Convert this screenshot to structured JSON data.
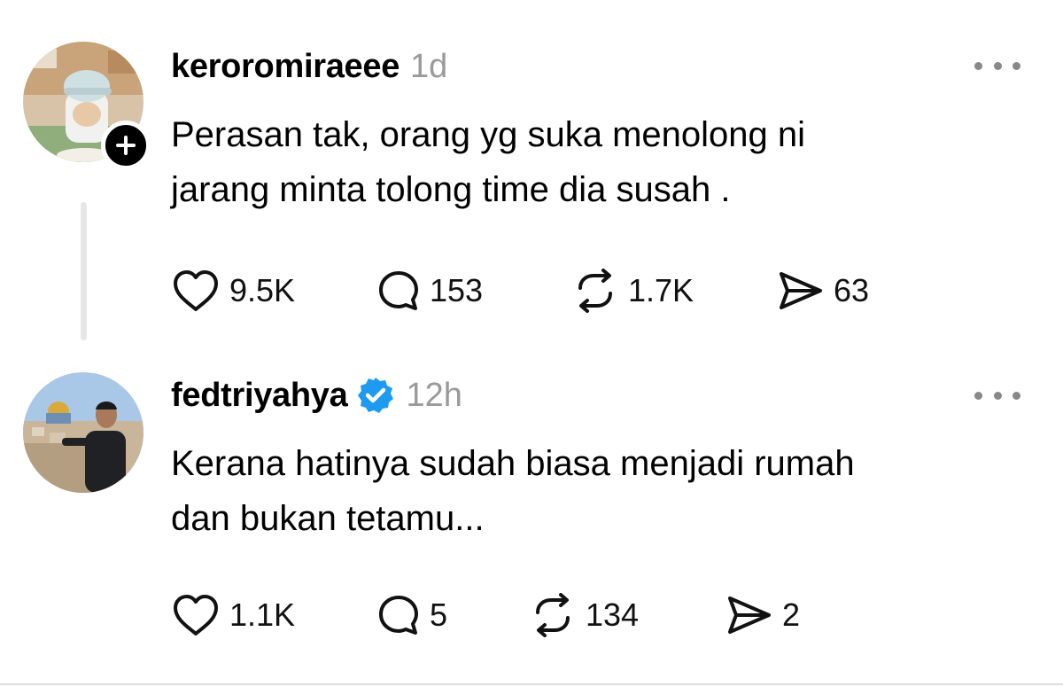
{
  "posts": [
    {
      "username": "keroromiraeee",
      "timestamp": "1d",
      "verified": false,
      "lines": [
        "Perasan tak, orang yg suka menolong ni",
        "jarang minta tolong time dia susah ."
      ],
      "likes": "9.5K",
      "replies": "153",
      "reposts": "1.7K",
      "shares": "63"
    },
    {
      "username": "fedtriyahya",
      "timestamp": "12h",
      "verified": true,
      "lines": [
        "Kerana hatinya sudah biasa menjadi rumah",
        "dan bukan tetamu..."
      ],
      "likes": "1.1K",
      "replies": "5",
      "reposts": "134",
      "shares": "2"
    }
  ],
  "colors": {
    "verified_badge": "#1d9bf0",
    "timestamp": "#9a9a9a",
    "thread_line": "#e6e6e6"
  },
  "icons": [
    "heart-icon",
    "comment-icon",
    "repost-icon",
    "share-icon",
    "more-icon",
    "plus-icon",
    "verified-icon"
  ]
}
